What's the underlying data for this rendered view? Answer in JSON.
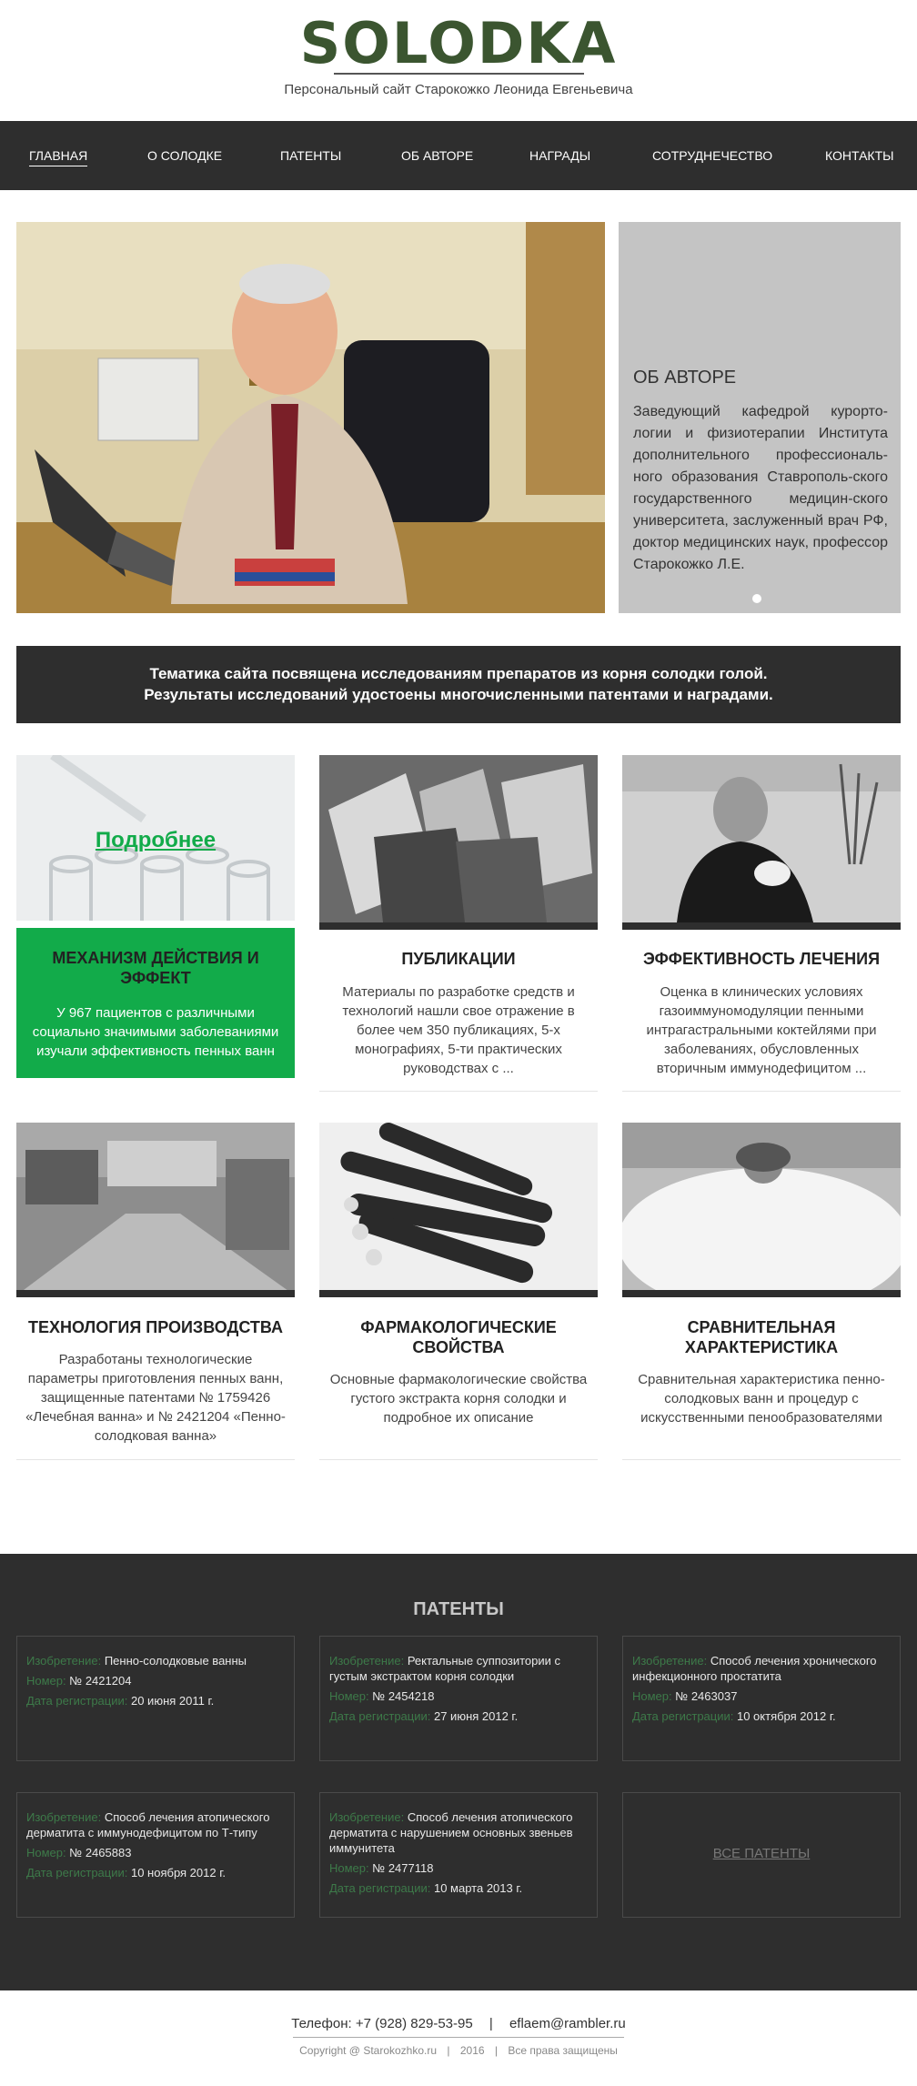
{
  "site": {
    "logo": "SOLODKA",
    "tagline": "Персональный сайт Старокожко Леонида Евгеньевича"
  },
  "nav": [
    {
      "label": "ГЛАВНАЯ"
    },
    {
      "label": "О СОЛОДКЕ"
    },
    {
      "label": "ПАТЕНТЫ"
    },
    {
      "label": "ОБ АВТОРЕ"
    },
    {
      "label": "НАГРАДЫ"
    },
    {
      "label": "СОТРУДНЕЧЕСТВО"
    },
    {
      "label": "КОНТАКТЫ"
    }
  ],
  "hero": {
    "title": "ОБ АВТОРЕ",
    "text": "Заведующий кафедрой курорто-логии и физиотерапии Института дополнительного профессиональ-ного образования Ставрополь-ского государственного медицин-ского университета, заслуженный врач РФ, доктор медицинских наук, профессор Старокожко Л.Е."
  },
  "banner": {
    "line1": "Тематика сайта посвящена исследованиям препаратов из корня солодки голой.",
    "line2": "Результаты исследований удостоены многочисленными патентами и наградами."
  },
  "cards": [
    {
      "title": "МЕХАНИЗМ ДЕЙСТВИЯ И ЭФФЕКТ",
      "text": "У 967 пациентов с различными социально значимыми заболеваниями изучали эффективность пенных ванн",
      "more": "Подробнее"
    },
    {
      "title": "ПУБЛИКАЦИИ",
      "text": "Материалы по разработке средств и технологий нашли свое отражение в более чем 350 публикациях, 5-х монографиях, 5-ти практических руководствах с ..."
    },
    {
      "title": "ЭФФЕКТИВНОСТЬ ЛЕЧЕНИЯ",
      "text": "Оценка в клинических условиях газоиммуномодуляции пенными интрагастральными коктейлями при заболеваниях, обусловленных вторичным иммунодефицитом ..."
    },
    {
      "title": "ТЕХНОЛОГИЯ ПРОИЗВОДСТВА",
      "text": "Разработаны технологические параметры приготовления пенных ванн, защищенные патентами № 1759426 «Лечебная ванна» и № 2421204 «Пенно-солодковая ванна»"
    },
    {
      "title": "ФАРМАКОЛОГИЧЕСКИЕ СВОЙСТВА",
      "text": "Основные фармакологические свойства густого экстракта корня солодки и подробное их описание"
    },
    {
      "title": "СРАВНИТЕЛЬНАЯ ХАРАКТЕРИСТИКА",
      "text": "Сравнительная характеристика пенно-солодковых ванн и процедур с искусственными пенообразователями"
    }
  ],
  "patents": {
    "heading": "ПАТЕНТЫ",
    "label_invention": "Изобретение:",
    "label_number": "Номер:",
    "label_date": "Дата регистрации:",
    "items": [
      {
        "name": "Пенно-солодковые ванны",
        "number": "№ 2421204",
        "date": "20 июня 2011 г."
      },
      {
        "name": "Ректальные суппозитории с густым экстрактом корня солодки",
        "number": "№ 2454218",
        "date": "27 июня 2012 г."
      },
      {
        "name": "Способ лечения хронического инфекционного простатита",
        "number": "№ 2463037",
        "date": "10 октября 2012 г."
      },
      {
        "name": "Способ лечения атопического дерматита с иммунодефицитом по Т-типу",
        "number": "№ 2465883",
        "date": "10 ноября 2012 г."
      },
      {
        "name": "Способ лечения атопического дерматита с нарушением основных звеньев иммунитета",
        "number": "№ 2477118",
        "date": "10 марта 2013 г."
      }
    ],
    "all_link": "ВСЕ ПАТЕНТЫ"
  },
  "footer": {
    "phone_label": "Телефон:",
    "phone": "+7 (928) 829-53-95",
    "email": "eflaem@rambler.ru",
    "copyright": "Copyright @ Starokozhko.ru",
    "year": "2016",
    "rights": "Все права защищены"
  },
  "colors": {
    "dark": "#2e2e2e",
    "accent": "#12ab4a",
    "label": "#3d7a49"
  }
}
